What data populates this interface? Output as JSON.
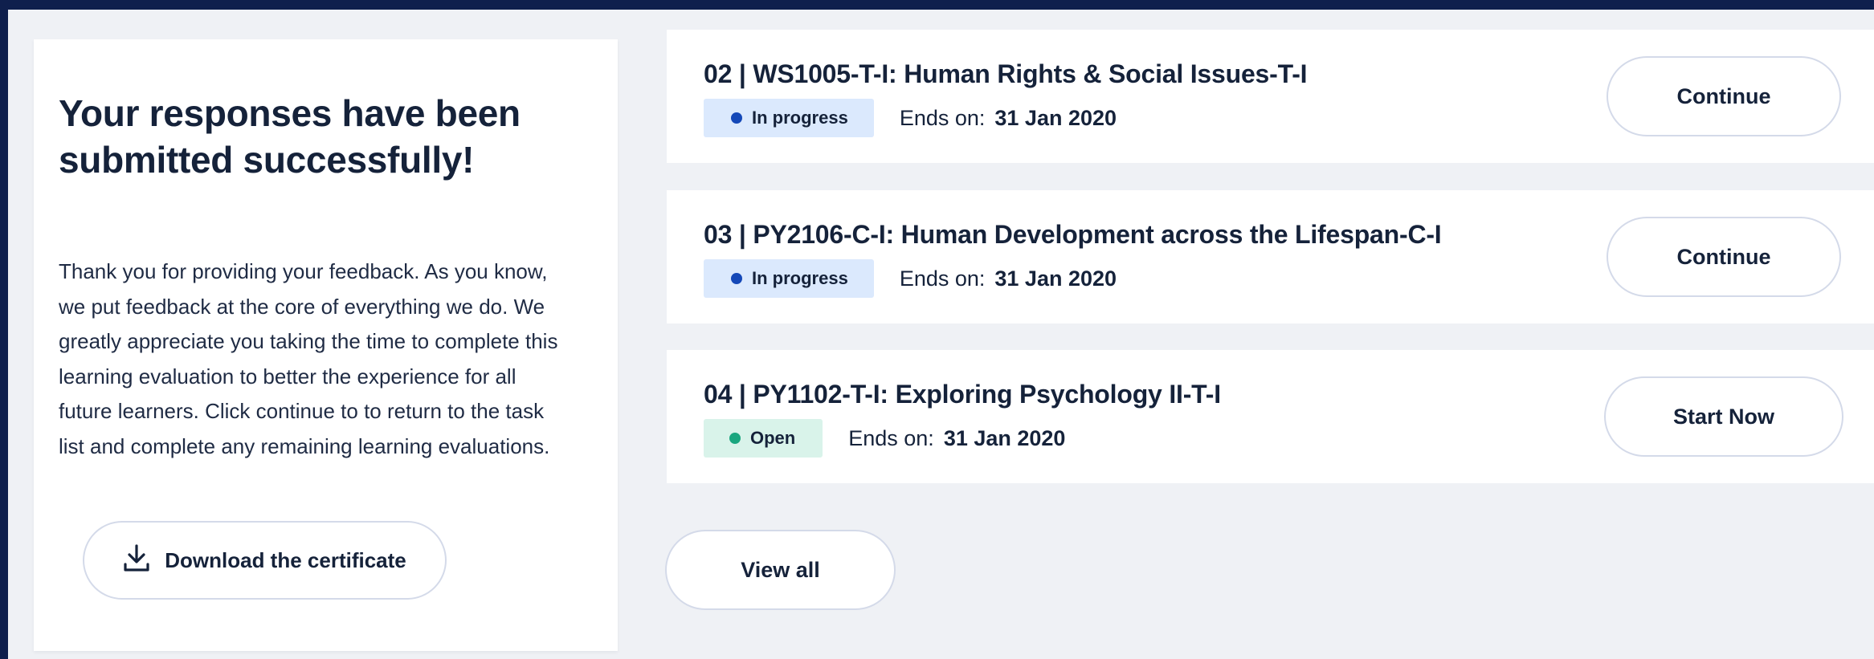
{
  "success_panel": {
    "title": "Your responses have been submitted successfully!",
    "body": "Thank you for providing your feedback. As you know, we put feedback at the core of everything we do. We greatly appreciate you taking the time to complete this learning evaluation to better the experience for all future learners. Click continue to to return to the task list and complete any remaining learning evaluations.",
    "download_label": "Download the certificate",
    "download_icon": "download-icon"
  },
  "tasks": [
    {
      "title": "02 | WS1005-T-I: Human Rights & Social Issues-T-I",
      "status": "In progress",
      "status_color": "#1448b8",
      "ends_label": "Ends on:",
      "ends_date": "31 Jan 2020",
      "action": "Continue"
    },
    {
      "title": "03 | PY2106-C-I: Human Development across the Lifespan-C-I",
      "status": "In progress",
      "status_color": "#1448b8",
      "ends_label": "Ends on:",
      "ends_date": "31 Jan 2020",
      "action": "Continue"
    },
    {
      "title": "04 | PY1102-T-I: Exploring Psychology II-T-I",
      "status": "Open",
      "status_color": "#1aa67f",
      "ends_label": "Ends on:",
      "ends_date": "31 Jan 2020",
      "action": "Start Now"
    }
  ],
  "view_all_label": "View all",
  "colors": {
    "frame_border": "#0f1f4d",
    "background": "#eff1f5",
    "text": "#15223a",
    "in_progress_badge": "#dbe9fd",
    "open_badge": "#d9f3ea"
  }
}
